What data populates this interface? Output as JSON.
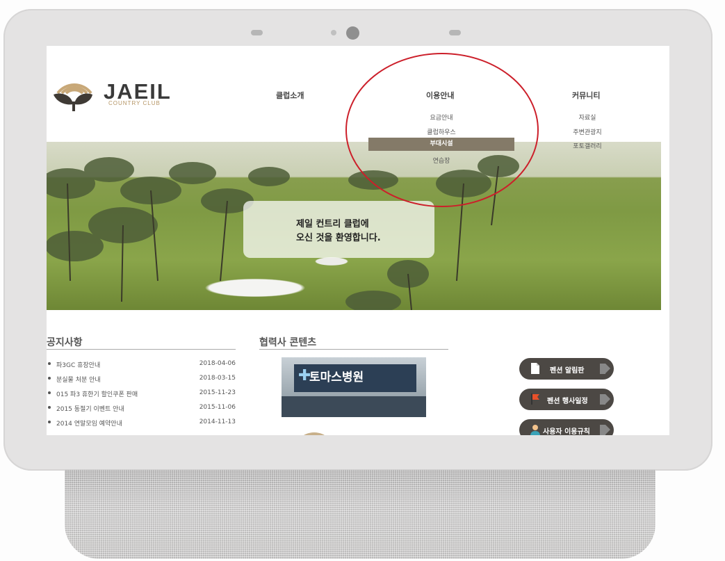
{
  "logo": {
    "name": "JAEIL",
    "sub": "COUNTRY CLUB"
  },
  "nav": {
    "club": "클럽소개",
    "usage": "이용안내",
    "community": "커뮤니티",
    "usage_sub": [
      "요금안내",
      "클럽하우스",
      "부대시설",
      "연습장"
    ],
    "community_sub": [
      "자료실",
      "주변관광지",
      "포토갤러리"
    ]
  },
  "banner": {
    "line1": "제일 컨트리 클럽에",
    "line2": "오신 것을 환영합니다."
  },
  "notice": {
    "title": "공지사항",
    "items": [
      {
        "title": "파3GC 휴장안내",
        "date": "2018-04-06"
      },
      {
        "title": "분실물 처분 안내",
        "date": "2018-03-15"
      },
      {
        "title": "015 파3 휴한기 할인쿠폰 판매",
        "date": "2015-11-23"
      },
      {
        "title": "2015 동절기 이벤트 안내",
        "date": "2015-11-06"
      },
      {
        "title": "2014 연말모임 예약안내",
        "date": "2014-11-13"
      }
    ]
  },
  "partner": {
    "title": "협력사 콘텐츠",
    "sign": "토마스병원"
  },
  "side_buttons": [
    {
      "label": "펜션 알림판",
      "icon": "document-icon"
    },
    {
      "label": "펜션 행사일정",
      "icon": "flag-icon"
    },
    {
      "label": "사용자 이용규칙",
      "icon": "user-icon"
    }
  ],
  "colors": {
    "active_menu": "#847a68",
    "button_bg": "#4c4844",
    "annotation": "#cc1f2a",
    "logo_accent": "#b59564"
  }
}
